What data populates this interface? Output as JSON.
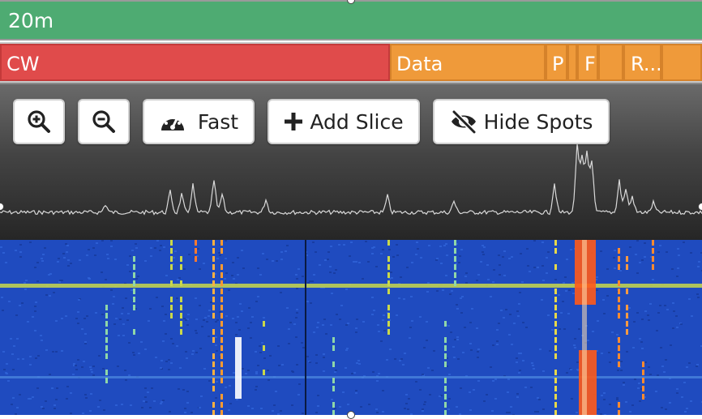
{
  "band": {
    "label": "20m"
  },
  "modes": [
    {
      "label": "CW",
      "kind": "cw"
    },
    {
      "label": "Data",
      "kind": "data"
    },
    {
      "label": "P",
      "kind": "data"
    },
    {
      "label": "",
      "kind": "data"
    },
    {
      "label": "F",
      "kind": "data"
    },
    {
      "label": "",
      "kind": "data"
    },
    {
      "label": "R...",
      "kind": "data"
    },
    {
      "label": "",
      "kind": "data"
    }
  ],
  "toolbar": {
    "zoom_in_icon": "zoom-in-icon",
    "zoom_out_icon": "zoom-out-icon",
    "speed_label": "Fast",
    "add_slice_label": "Add Slice",
    "hide_spots_label": "Hide Spots"
  },
  "colors": {
    "band": "#4eab72",
    "cw": "#e04b4b",
    "data": "#ef9a3a",
    "waterfall_bg": "#1f4bbf",
    "waterfall_line": "#c9d84a",
    "waterfall_hot": "#ff5a1a"
  }
}
